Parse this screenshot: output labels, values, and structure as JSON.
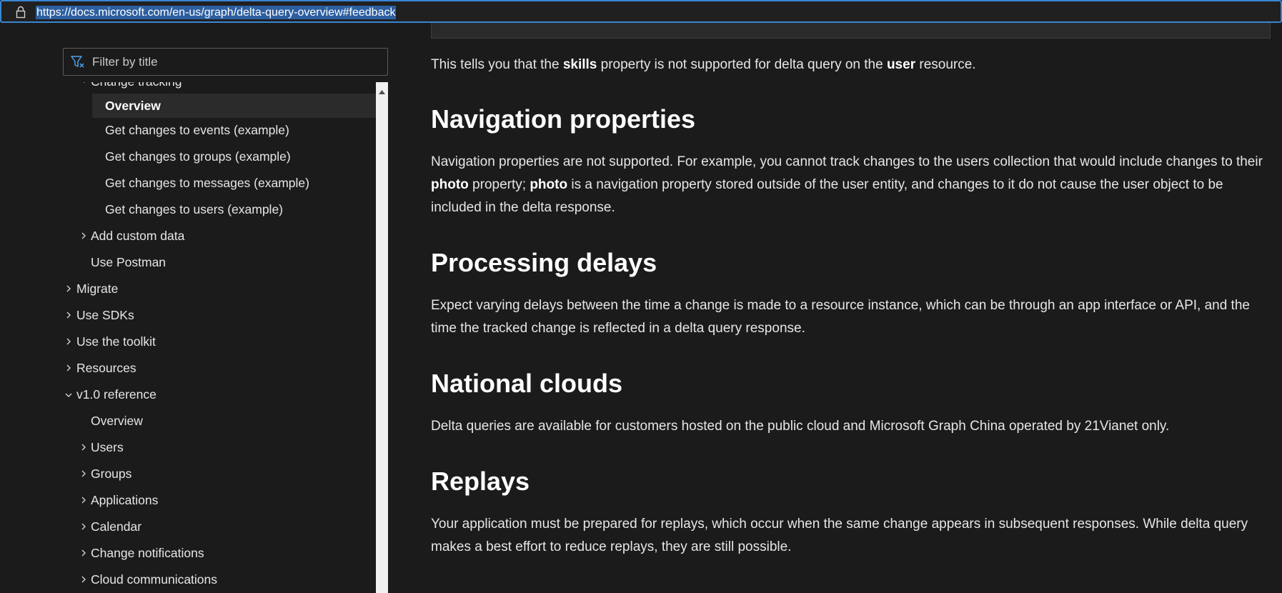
{
  "browser": {
    "url": "https://docs.microsoft.com/en-us/graph/delta-query-overview#feedback"
  },
  "nav": {
    "filter_placeholder": "Filter by title",
    "items": [
      {
        "label": "Change tracking",
        "expanded": true
      },
      {
        "label": "Overview",
        "active": true
      },
      {
        "label": "Get changes to events (example)"
      },
      {
        "label": "Get changes to groups (example)"
      },
      {
        "label": "Get changes to messages (example)"
      },
      {
        "label": "Get changes to users (example)"
      },
      {
        "label": "Add custom data",
        "expanded": false
      },
      {
        "label": "Use Postman"
      },
      {
        "label": "Migrate",
        "expanded": false
      },
      {
        "label": "Use SDKs",
        "expanded": false
      },
      {
        "label": "Use the toolkit",
        "expanded": false
      },
      {
        "label": "Resources",
        "expanded": false
      },
      {
        "label": "v1.0 reference",
        "expanded": true
      },
      {
        "label": "Overview"
      },
      {
        "label": "Users",
        "expanded": false
      },
      {
        "label": "Groups",
        "expanded": false
      },
      {
        "label": "Applications",
        "expanded": false
      },
      {
        "label": "Calendar",
        "expanded": false
      },
      {
        "label": "Change notifications",
        "expanded": false
      },
      {
        "label": "Cloud communications",
        "expanded": false
      }
    ]
  },
  "content": {
    "intro": {
      "t1": "This tells you that the ",
      "b1": "skills",
      "t2": " property is not supported for delta query on the ",
      "b2": "user",
      "t3": " resource."
    },
    "nav_props": {
      "heading": "Navigation properties",
      "t1": "Navigation properties are not supported. For example, you cannot track changes to the users collection that would include changes to their ",
      "b1": "photo",
      "t2": " property; ",
      "b2": "photo",
      "t3": " is a navigation property stored outside of the user entity, and changes to it do not cause the user object to be included in the delta response."
    },
    "processing": {
      "heading": "Processing delays",
      "text": "Expect varying delays between the time a change is made to a resource instance, which can be through an app interface or API, and the time the tracked change is reflected in a delta query response."
    },
    "national": {
      "heading": "National clouds",
      "text": "Delta queries are available for customers hosted on the public cloud and Microsoft Graph China operated by 21Vianet only."
    },
    "replays": {
      "heading": "Replays",
      "text": "Your application must be prepared for replays, which occur when the same change appears in subsequent responses. While delta query makes a best effort to reduce replays, they are still possible."
    }
  },
  "colors": {
    "background": "#1b1b1b",
    "url_selection": "#2d5fa0",
    "address_border": "#3a86d4",
    "active_item_bg": "#2b2b2b",
    "filter_icon": "#4ea1e8"
  }
}
